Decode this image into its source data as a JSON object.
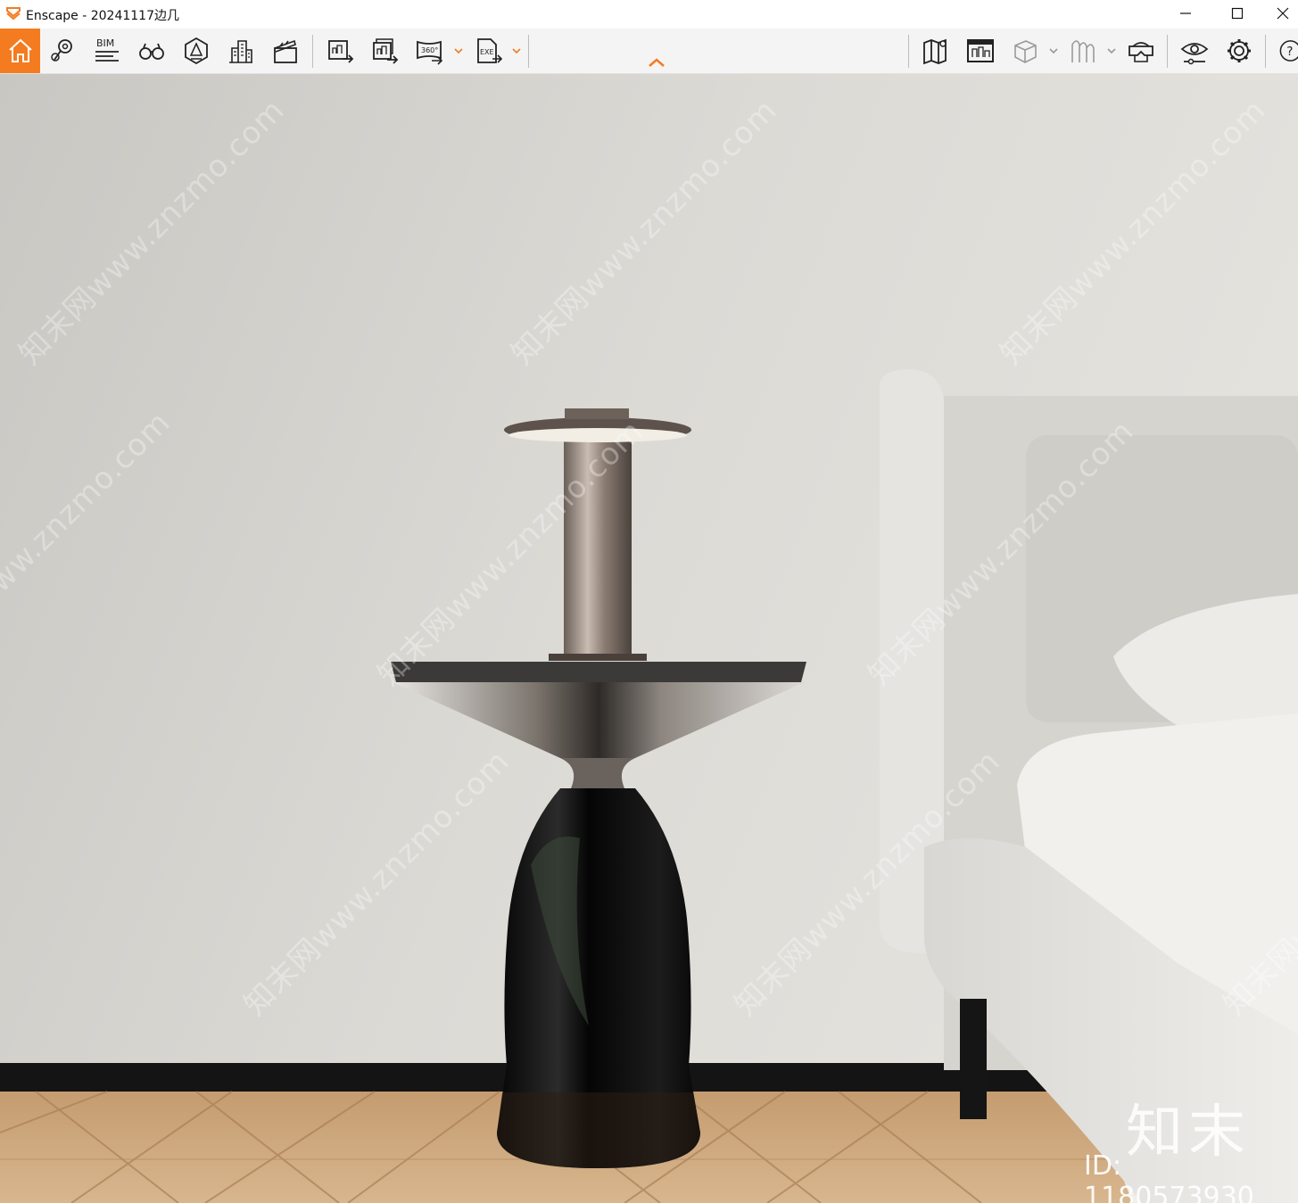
{
  "window": {
    "title": "Enscape - 20241117边几",
    "controls": [
      "minimize-icon",
      "maximize-icon",
      "close-icon"
    ]
  },
  "toolbar": {
    "accent": "#f47b20",
    "bim_label": "BIM",
    "pano_label": "360°",
    "exe_label": "EXE",
    "left_tools": [
      "home-icon",
      "location-pin-icon",
      "bim-icon",
      "binoculars-icon",
      "safe-frame-icon",
      "buildings-icon",
      "clapperboard-icon",
      "render-image-icon",
      "batch-render-icon",
      "panorama-360-icon",
      "export-exe-icon"
    ],
    "right_tools": [
      "map-icon",
      "asset-library-icon",
      "view-cube-icon",
      "material-icon",
      "vr-headset-icon",
      "visual-settings-icon",
      "settings-gear-icon",
      "help-icon"
    ]
  },
  "viewport": {
    "watermark_text": "知末网www.znzmo.com",
    "brand_text": "知末",
    "id_text": "ID: 1180573930"
  }
}
